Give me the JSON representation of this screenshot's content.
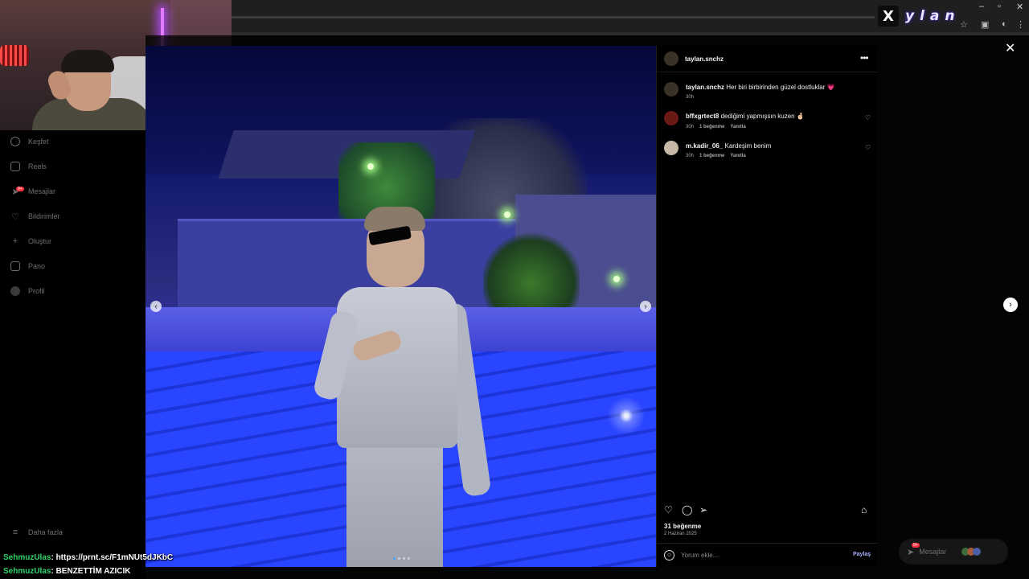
{
  "stream_logo": {
    "mark": "X",
    "word": "ylan"
  },
  "browser": {
    "window_controls": [
      "–",
      "▫",
      "✕"
    ]
  },
  "nav": {
    "items": [
      {
        "label": "Keşfet",
        "icon": "compass-icon"
      },
      {
        "label": "Reels",
        "icon": "reels-icon"
      },
      {
        "label": "Mesajlar",
        "icon": "messenger-icon",
        "badge": "9+"
      },
      {
        "label": "Bildirimler",
        "icon": "heart-icon"
      },
      {
        "label": "Oluştur",
        "icon": "plus-icon"
      },
      {
        "label": "Pano",
        "icon": "dashboard-icon"
      },
      {
        "label": "Profil",
        "icon": "profile-avatar"
      }
    ],
    "more": {
      "label": "Daha fazla",
      "icon": "menu-icon"
    }
  },
  "chat": [
    {
      "user": "SehmuzUlas",
      "message": ": https://prnt.sc/F1mNUt5dJKbC"
    },
    {
      "user": "SehmuzUlas",
      "message": ": BENZETTİM AZICIK"
    }
  ],
  "post": {
    "author": "taylan.snchz",
    "caption": {
      "user": "taylan.snchz",
      "text": "Her biri birbirinden güzel dostluklar",
      "emoji": "💗",
      "time": "30h"
    },
    "comments": [
      {
        "user": "bffxgrtect8",
        "text": "dediğimi yapmışsın kuzen",
        "emoji": "🤞🏻",
        "time": "30h",
        "likes": "1 beğenme",
        "reply": "Yanıtla",
        "avatar_color": "#6a1a14"
      },
      {
        "user": "m.kadir_06_",
        "text": "Kardeşim benim",
        "emoji": "",
        "time": "30h",
        "likes": "1 beğenme",
        "reply": "Yanıtla",
        "avatar_color": "#c8b8a8"
      }
    ],
    "likes": "31 beğenme",
    "date": "2 Haziran 2025",
    "comment_placeholder": "Yorum ekle...",
    "share_label": "Paylaş",
    "carousel": {
      "slides": 4,
      "active": 1
    }
  },
  "messages_pill": {
    "label": "Mesajlar",
    "badge": "9+"
  },
  "colors": {
    "accent_blue": "#4ca3ff",
    "like_red": "#ff3040",
    "chat_user": "#34d36a"
  }
}
